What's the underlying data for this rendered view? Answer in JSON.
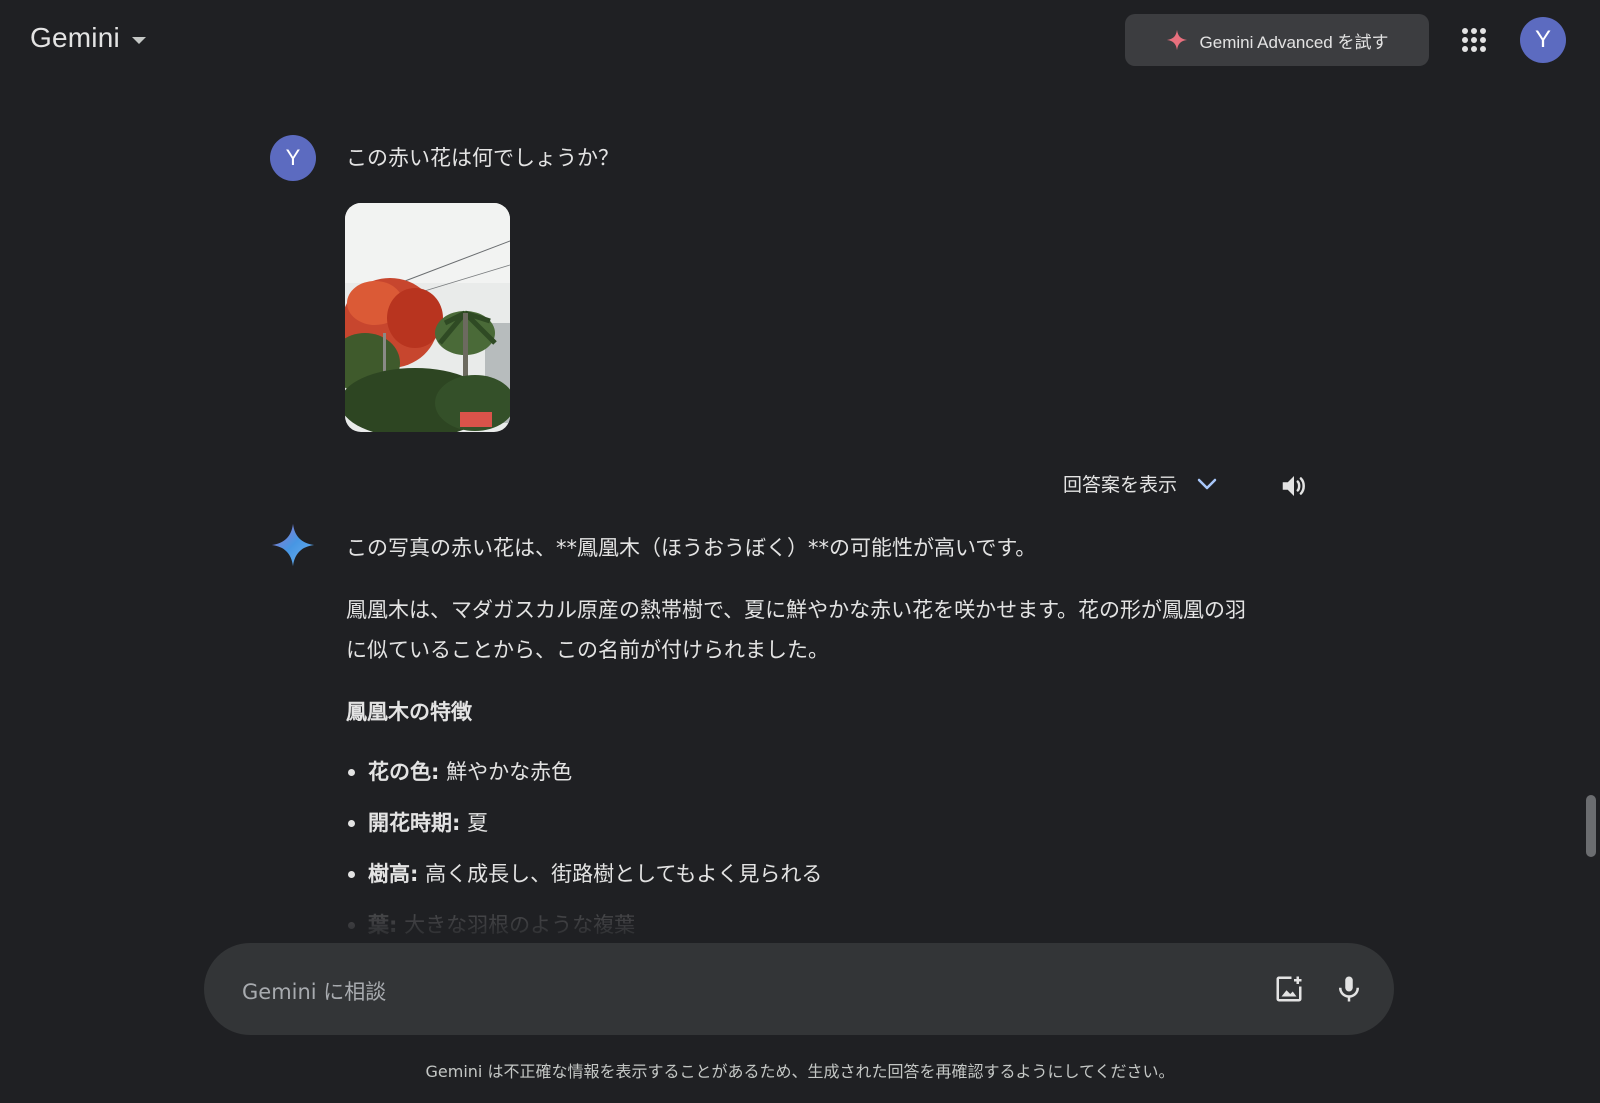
{
  "header": {
    "logo": "Gemini",
    "advanced_button": "Gemini Advanced を試す",
    "avatar_letter": "Y"
  },
  "user_message": {
    "avatar_letter": "Y",
    "text": "この赤い花は何でしょうか？"
  },
  "response_controls": {
    "drafts_label": "回答案を表示"
  },
  "response": {
    "intro": "この写真の赤い花は、**鳳凰木（ほうおうぼく）**の可能性が高いです。",
    "paragraph": "鳳凰木は、マダガスカル原産の熱帯樹で、夏に鮮やかな赤い花を咲かせます。花の形が鳳凰の羽に似ていることから、この名前が付けられました。",
    "heading": "鳳凰木の特徴",
    "features": [
      {
        "term": "花の色:",
        "desc": "鮮やかな赤色"
      },
      {
        "term": "開花時期:",
        "desc": "夏"
      },
      {
        "term": "樹高:",
        "desc": "高く成長し、街路樹としてもよく見られる"
      },
      {
        "term": "葉:",
        "desc": "大きな羽根のような複葉"
      }
    ]
  },
  "input": {
    "placeholder": "Gemini に相談"
  },
  "footer": {
    "disclaimer": "Gemini は不正確な情報を表示することがあるため、生成された回答を再確認するようにしてください。"
  },
  "colors": {
    "background": "#1f2023",
    "avatar": "#5c6bc0",
    "input_bar": "#333537",
    "advanced_button": "#3c3d40"
  }
}
